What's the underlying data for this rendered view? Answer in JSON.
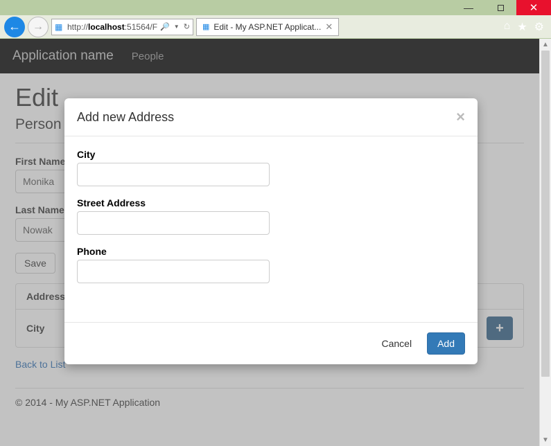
{
  "window": {
    "url_prefix": "http://",
    "url_host": "localhost",
    "url_suffix": ":51564/F",
    "tab_title": "Edit - My ASP.NET Applicat..."
  },
  "navbar": {
    "brand": "Application name",
    "link_people": "People"
  },
  "page": {
    "title": "Edit",
    "subtitle": "Person",
    "first_name_label": "First Name",
    "first_name_value": "Monika",
    "last_name_label": "Last Name",
    "last_name_value": "Nowak",
    "save_label": "Save",
    "panel_heading": "Addresses",
    "panel_col_city": "City",
    "back_link": "Back to List",
    "footer": "© 2014 - My ASP.NET Application"
  },
  "modal": {
    "title": "Add new Address",
    "city_label": "City",
    "city_value": "",
    "street_label": "Street Address",
    "street_value": "",
    "phone_label": "Phone",
    "phone_value": "",
    "cancel_label": "Cancel",
    "add_label": "Add"
  }
}
